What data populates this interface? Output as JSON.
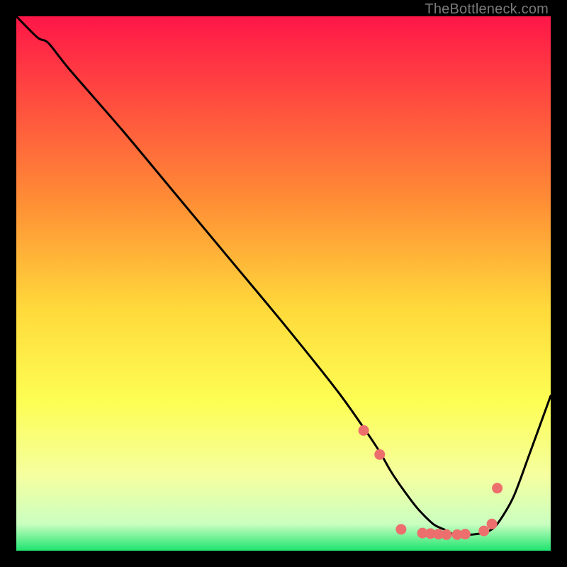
{
  "attribution": "TheBottleneck.com",
  "colors": {
    "black": "#000000",
    "line": "#000000",
    "dot": "#ec6f6d",
    "grad_top": "#ff1648",
    "grad_mid1": "#ff8f35",
    "grad_mid2": "#ffda3b",
    "grad_mid3": "#fdfe53",
    "grad_low1": "#f5ffa0",
    "grad_low2": "#caffc0",
    "grad_bottom": "#1ee46f"
  },
  "chart_data": {
    "type": "line",
    "title": "",
    "xlabel": "",
    "ylabel": "",
    "xlim": [
      0,
      100
    ],
    "ylim": [
      0,
      100
    ],
    "series": [
      {
        "name": "curve",
        "x": [
          0,
          4,
          6,
          10,
          20,
          30,
          40,
          50,
          60,
          65,
          68,
          70,
          72,
          75,
          78,
          80,
          82,
          85,
          88,
          90,
          93,
          96,
          100
        ],
        "y": [
          100,
          96,
          95,
          90,
          78.5,
          66.5,
          54.5,
          42.5,
          30,
          23,
          18.5,
          15,
          12,
          8,
          5,
          4,
          3,
          3,
          3.5,
          5,
          10,
          18,
          29
        ]
      }
    ],
    "dots": {
      "x": [
        65.0,
        68.0,
        72.0,
        76.0,
        77.5,
        79.0,
        80.5,
        82.5,
        84.0,
        87.5,
        89.0,
        90.0
      ],
      "y": [
        22.5,
        18.0,
        4.0,
        3.3,
        3.2,
        3.1,
        3.0,
        3.0,
        3.1,
        3.7,
        5.0,
        11.7
      ]
    }
  }
}
